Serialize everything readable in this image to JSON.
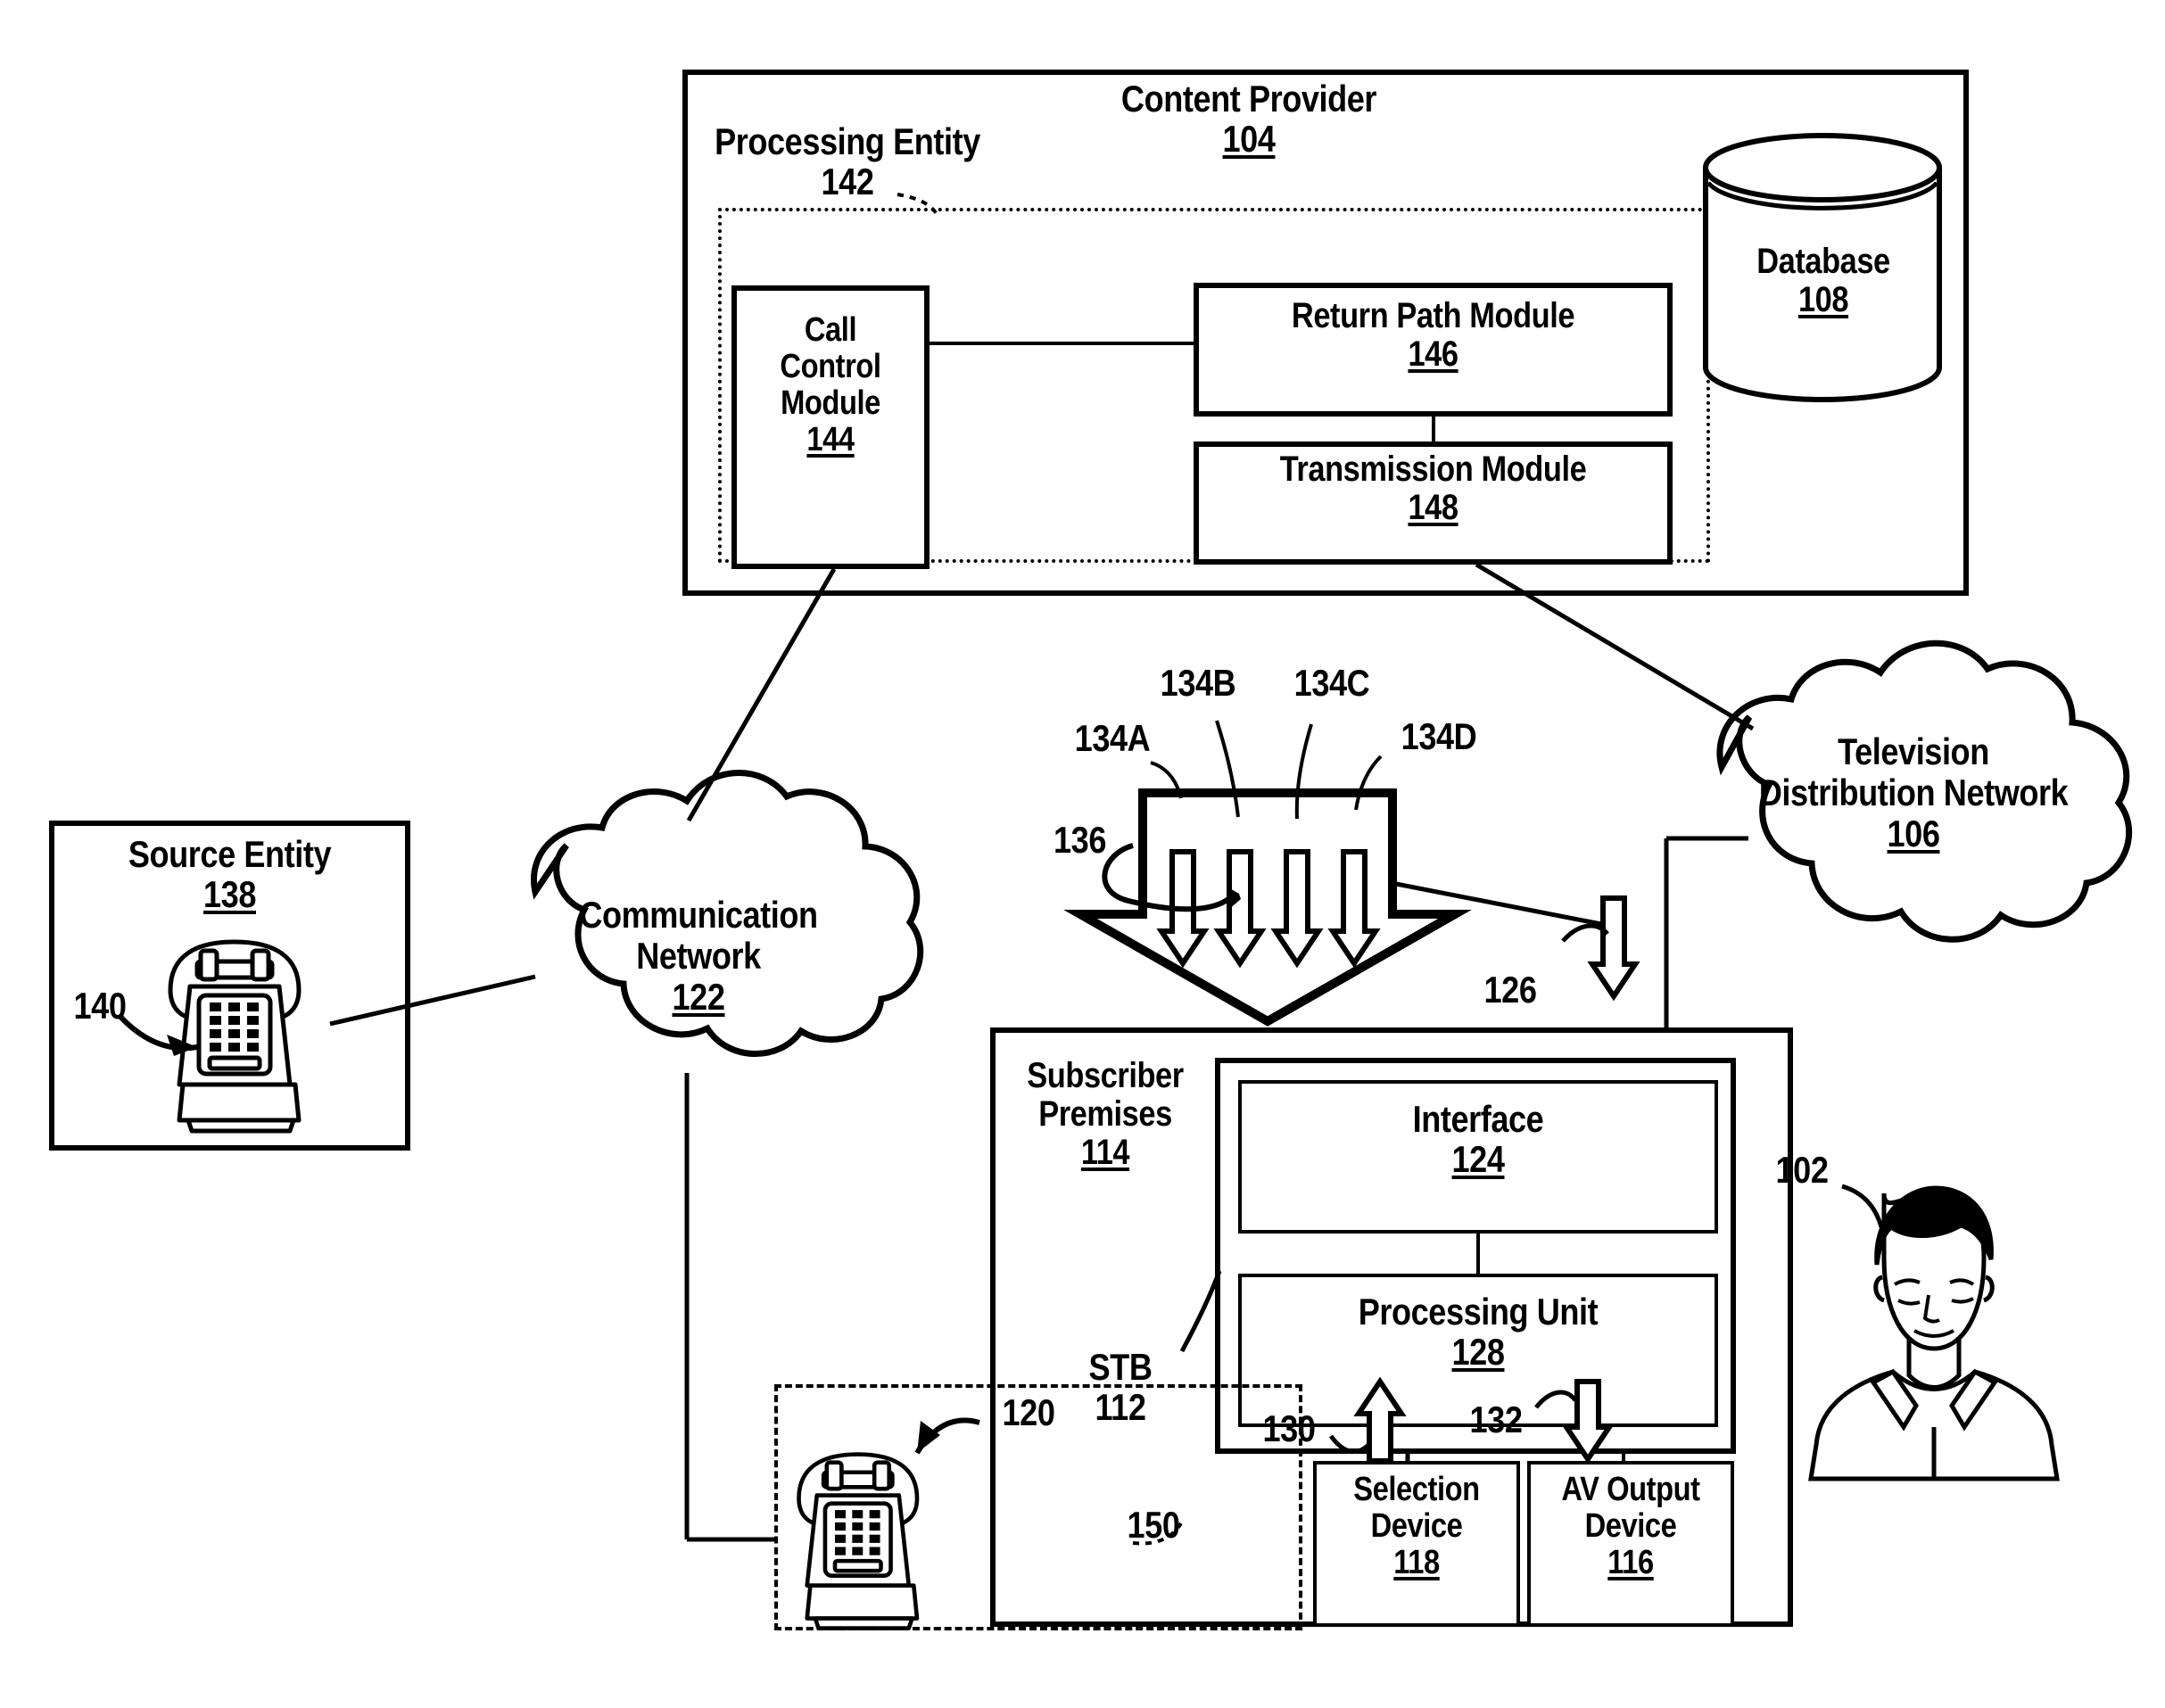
{
  "figure": {
    "type": "patent-system-diagram",
    "content_provider": {
      "title": "Content Provider",
      "ref": "104",
      "processing_entity": {
        "title": "Processing Entity",
        "ref": "142"
      },
      "modules": [
        {
          "name": "call-control-module",
          "lines": [
            "Call",
            "Control",
            "Module"
          ],
          "ref": "144"
        },
        {
          "name": "return-path-module",
          "lines": [
            "Return Path Module"
          ],
          "ref": "146"
        },
        {
          "name": "transmission-module",
          "lines": [
            "Transmission Module"
          ],
          "ref": "148"
        }
      ],
      "database": {
        "title": "Database",
        "ref": "108"
      }
    },
    "networks": [
      {
        "name": "communication-network",
        "lines": [
          "Communication",
          "Network"
        ],
        "ref": "122"
      },
      {
        "name": "television-distribution-network",
        "lines": [
          "Television",
          "Distribution Network"
        ],
        "ref": "106"
      }
    ],
    "source_entity": {
      "title": "Source Entity",
      "ref": "138",
      "telephone_ref": "140"
    },
    "subscriber_premises": {
      "title_lines": [
        "Subscriber",
        "Premises"
      ],
      "ref": "114",
      "stb": {
        "label": "STB",
        "ref": "112"
      },
      "stb_blocks": [
        {
          "name": "interface",
          "label": "Interface",
          "ref": "124"
        },
        {
          "name": "processing-unit",
          "label": "Processing Unit",
          "ref": "128"
        }
      ],
      "devices": [
        {
          "name": "selection-device",
          "lines": [
            "Selection",
            "Device"
          ],
          "ref": "118"
        },
        {
          "name": "av-output-device",
          "lines": [
            "AV Output",
            "Device"
          ],
          "ref": "116"
        }
      ],
      "telephone_ref": "120",
      "dotted_region_ref": "150",
      "arrow_refs": {
        "selection_up": "130",
        "av_down": "132",
        "downlink": "126"
      }
    },
    "stream_arrows": {
      "group_ref": "136",
      "items": [
        "134A",
        "134B",
        "134C",
        "134D"
      ]
    },
    "viewer_ref": "102"
  }
}
